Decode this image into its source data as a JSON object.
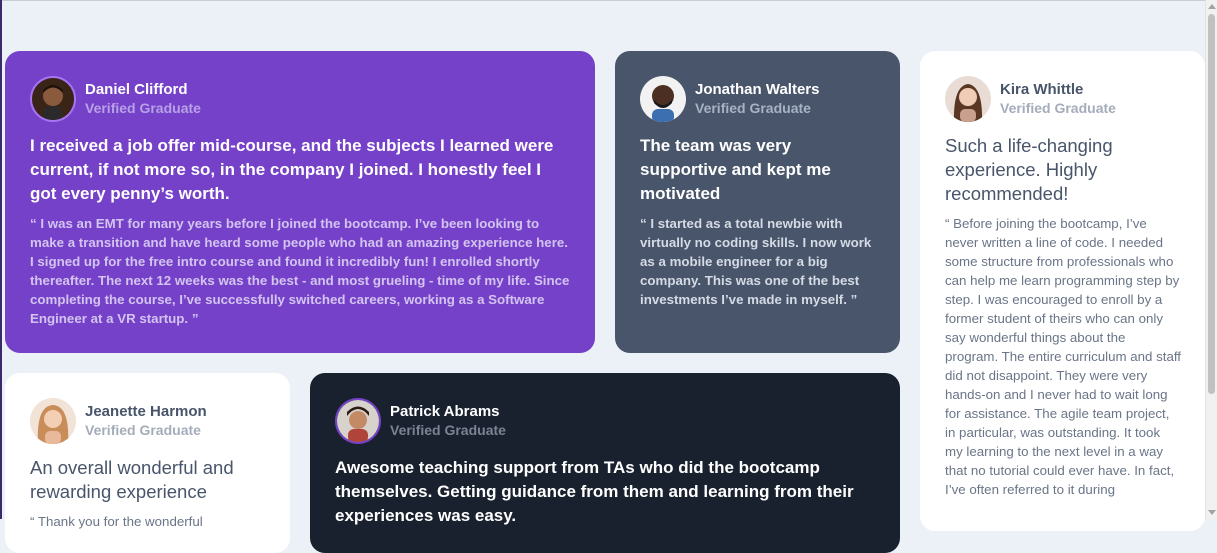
{
  "testimonials": [
    {
      "name": "Daniel Clifford",
      "role": "Verified Graduate",
      "title": "I received a job offer mid-course, and the subjects I learned were current, if not more so, in the company I joined. I honestly feel I got every penny’s worth.",
      "body": "“ I was an EMT for many years before I joined the bootcamp. I’ve been looking to make a transition and have heard some people who had an amazing experience here. I signed up for the free intro course and found it incredibly fun! I enrolled shortly thereafter. The next 12 weeks was the best - and most grueling - time of my life. Since completing the course, I’ve successfully switched careers, working as a Software Engineer at a VR startup. ”",
      "avatar_icon": "avatar-daniel-clifford"
    },
    {
      "name": "Jonathan Walters",
      "role": "Verified Graduate",
      "title": "The team was very supportive and kept me motivated",
      "body": "“ I started as a total newbie with virtually no coding skills. I now work as a mobile engineer for a big company. This was one of the best investments I’ve made in myself. ”",
      "avatar_icon": "avatar-jonathan-walters"
    },
    {
      "name": "Kira Whittle",
      "role": "Verified Graduate",
      "title": "Such a life-changing experience. Highly recommended!",
      "body": "“ Before joining the bootcamp, I’ve never written a line of code. I needed some structure from professionals who can help me learn programming step by step. I was encouraged to enroll by a former student of theirs who can only say wonderful things about the program. The entire curriculum and staff did not disappoint. They were very hands-on and I never had to wait long for assistance. The agile team project, in particular, was outstanding. It took my learning to the next level in a way that no tutorial could ever have. In fact, I’ve often referred to it during",
      "avatar_icon": "avatar-kira-whittle"
    },
    {
      "name": "Jeanette Harmon",
      "role": "Verified Graduate",
      "title": "An overall wonderful and rewarding experience",
      "body": "“ Thank you for the wonderful",
      "avatar_icon": "avatar-jeanette-harmon"
    },
    {
      "name": "Patrick Abrams",
      "role": "Verified Graduate",
      "title": "Awesome teaching support from TAs who did the bootcamp themselves. Getting guidance from them and learning from their experiences was easy.",
      "avatar_icon": "avatar-patrick-abrams"
    }
  ],
  "colors": {
    "purple": "#7541c8",
    "slate": "#48556a",
    "dark": "#19212e",
    "white": "#ffffff",
    "page": "#ecf1f8"
  }
}
